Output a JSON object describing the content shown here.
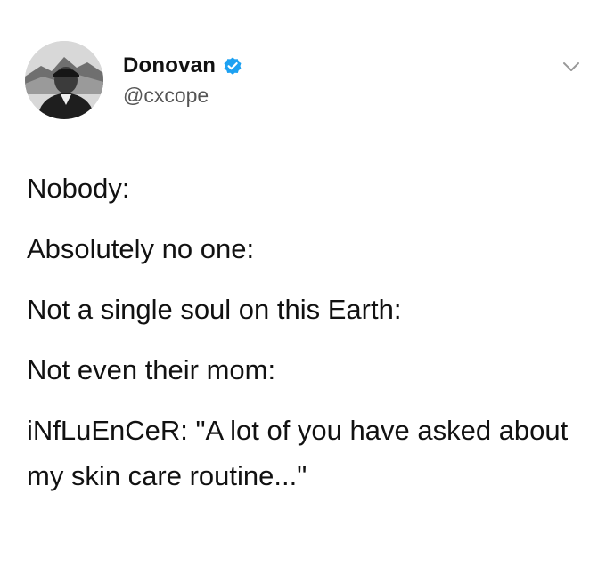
{
  "tweet": {
    "author": {
      "display_name": "Donovan",
      "handle": "@cxcope",
      "verified": true
    },
    "lines": [
      "Nobody:",
      "Absolutely no one:",
      "Not a single soul on this Earth:",
      "Not even their mom:",
      "iNfLuEnCeR: \"A lot of you have asked about my skin care routine...\""
    ]
  },
  "colors": {
    "verified_badge": "#1da1f2",
    "text": "#111111",
    "handle": "#555555",
    "chevron": "#999999"
  },
  "icons": {
    "verified": "verified-badge-icon",
    "menu": "chevron-down-icon"
  }
}
